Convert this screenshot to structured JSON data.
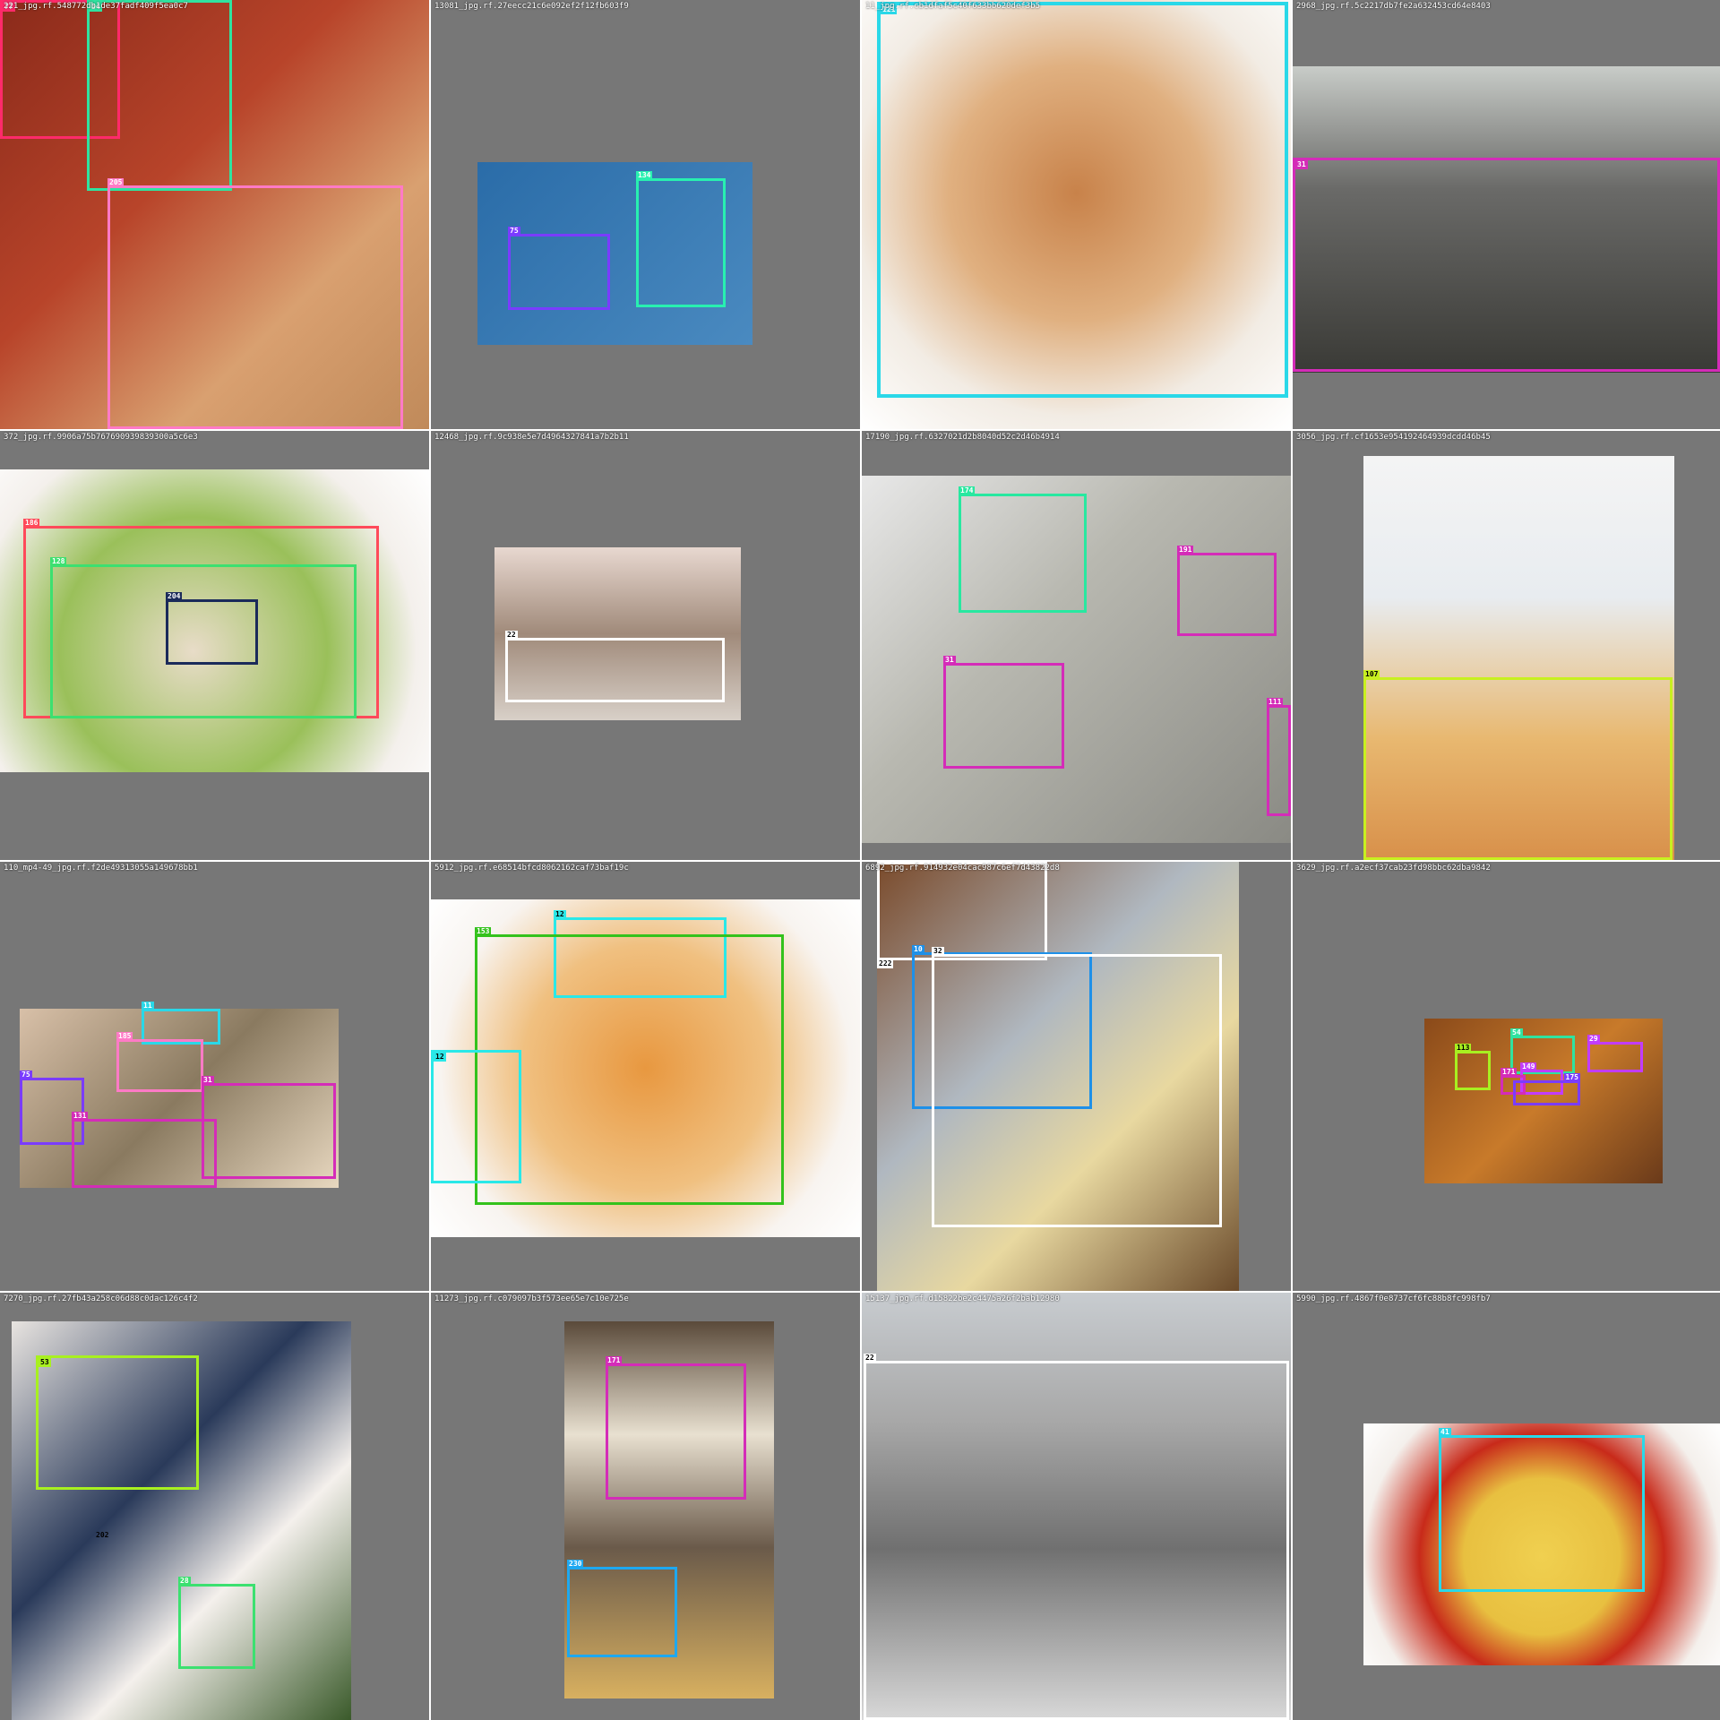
{
  "grid": {
    "tiles": [
      {
        "filename": "221_jpg.rf.548772db1de37fadf409f5ea0c7",
        "boxes": [
          {
            "label": "77",
            "color": "#ff2a6a"
          },
          {
            "label": "54",
            "color": "#2fe3a0"
          },
          {
            "label": "205",
            "color": "#ff7ac6"
          }
        ]
      },
      {
        "filename": "13081_jpg.rf.27eecc21c6e092ef2f12fb603f9",
        "boxes": [
          {
            "label": "75",
            "color": "#7a3cff"
          },
          {
            "label": "134",
            "color": "#28f0b0"
          }
        ]
      },
      {
        "filename": "11_jpg.rf.cb1dfaf5c40f633bb620def3b5",
        "boxes": [
          {
            "label": "121",
            "color": "#2ad8e8"
          }
        ]
      },
      {
        "filename": "2968_jpg.rf.5c2217db7fe2a632453cd64e8403",
        "boxes": [
          {
            "label": "31",
            "color": "#d42cb8"
          }
        ]
      },
      {
        "filename": "372_jpg.rf.9906a75b767690939839300a5c6e3",
        "boxes": [
          {
            "label": "186",
            "color": "#ff4a5a"
          },
          {
            "label": "128",
            "color": "#3ce070"
          },
          {
            "label": "204",
            "color": "#1a2a5a"
          }
        ]
      },
      {
        "filename": "12468_jpg.rf.9c938e5e7d4964327841a7b2b11",
        "boxes": [
          {
            "label": "22",
            "color": "#ffffff"
          }
        ]
      },
      {
        "filename": "17190_jpg.rf.6327021d2b8040d52c2d46b4914",
        "boxes": [
          {
            "label": "174",
            "color": "#28e8a0"
          },
          {
            "label": "191",
            "color": "#d42cb8"
          },
          {
            "label": "31",
            "color": "#d42cb8"
          },
          {
            "label": "111",
            "color": "#d42cb8"
          }
        ]
      },
      {
        "filename": "3056_jpg.rf.cf1653e954192464939dcdd46b45",
        "boxes": [
          {
            "label": "107",
            "color": "#c8f020"
          }
        ]
      },
      {
        "filename": "110_mp4-49_jpg.rf.f2de49313055a149678bb1",
        "boxes": [
          {
            "label": "11",
            "color": "#2ad8e8"
          },
          {
            "label": "185",
            "color": "#ff7ac6"
          },
          {
            "label": "75",
            "color": "#7a3cff"
          },
          {
            "label": "31",
            "color": "#d42cb8"
          },
          {
            "label": "131",
            "color": "#d42cb8"
          }
        ]
      },
      {
        "filename": "5912_jpg.rf.e68514bfcd8062162caf73baf19c",
        "boxes": [
          {
            "label": "12",
            "color": "#2ae8e8"
          },
          {
            "label": "153",
            "color": "#34c21c"
          },
          {
            "label": "12",
            "color": "#2ae8e8"
          }
        ]
      },
      {
        "filename": "6892_jpg.rf.914932e04cac987c6ef7d43822d8",
        "boxes": [
          {
            "label": "222",
            "color": "#ffffff"
          },
          {
            "label": "10",
            "color": "#1e90e8"
          },
          {
            "label": "32",
            "color": "#ffffff"
          }
        ]
      },
      {
        "filename": "3629_jpg.rf.a2ecf37cab23fd98bbc62dba9842",
        "boxes": [
          {
            "label": "113",
            "color": "#a8f020"
          },
          {
            "label": "54",
            "color": "#2fe3a0"
          },
          {
            "label": "29",
            "color": "#c23cff"
          },
          {
            "label": "149",
            "color": "#c23cff"
          },
          {
            "label": "171",
            "color": "#d42cb8"
          },
          {
            "label": "175",
            "color": "#7a3cff"
          }
        ]
      },
      {
        "filename": "7270_jpg.rf.27fb43a258c06d88c0dac126c4f2",
        "boxes": [
          {
            "label": "53",
            "color": "#a8f020"
          },
          {
            "label": "202",
            "color": "#ffffff"
          },
          {
            "label": "28",
            "color": "#3ce070"
          }
        ]
      },
      {
        "filename": "11273_jpg.rf.c079097b3f573ee65e7c10e725e",
        "boxes": [
          {
            "label": "171",
            "color": "#d42cb8"
          },
          {
            "label": "230",
            "color": "#1ea8f0"
          }
        ]
      },
      {
        "filename": "15137_jpg.rf.d15822be2c4475a26f2bab12980",
        "boxes": [
          {
            "label": "22",
            "color": "#ffffff"
          }
        ]
      },
      {
        "filename": "5990_jpg.rf.4867f0e8737cf6fc88b8fc998fb7",
        "boxes": [
          {
            "label": "41",
            "color": "#2ad8e8"
          }
        ]
      }
    ]
  }
}
